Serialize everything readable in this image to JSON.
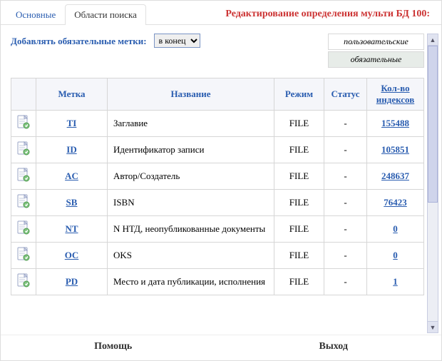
{
  "header": {
    "tab_main": "Основные",
    "tab_search": "Области поиска",
    "title": "Редактирование определения мульти БД 100:"
  },
  "controls": {
    "add_label": "Добавлять обязательные метки:",
    "select_value": "в конец",
    "legend_user": "пользовательские",
    "legend_required": "обязательные"
  },
  "table": {
    "headers": {
      "icon": "",
      "tag": "Метка",
      "name": "Название",
      "mode": "Режим",
      "status": "Статус",
      "count": "Кол-во индексов"
    },
    "rows": [
      {
        "tag": "TI",
        "name": "Заглавие",
        "mode": "FILE",
        "status": "-",
        "count": "155488"
      },
      {
        "tag": "ID",
        "name": "Идентификатор записи",
        "mode": "FILE",
        "status": "-",
        "count": "105851"
      },
      {
        "tag": "AC",
        "name": "Автор/Создатель",
        "mode": "FILE",
        "status": "-",
        "count": "248637"
      },
      {
        "tag": "SB",
        "name": "ISBN",
        "mode": "FILE",
        "status": "-",
        "count": "76423"
      },
      {
        "tag": "NT",
        "name": "N НТД, неопубликованные документы",
        "mode": "FILE",
        "status": "-",
        "count": "0"
      },
      {
        "tag": "OC",
        "name": "OKS",
        "mode": "FILE",
        "status": "-",
        "count": "0"
      },
      {
        "tag": "PD",
        "name": "Место и дата публикации, исполнения",
        "mode": "FILE",
        "status": "-",
        "count": "1"
      }
    ]
  },
  "footer": {
    "help": "Помощь",
    "exit": "Выход"
  }
}
